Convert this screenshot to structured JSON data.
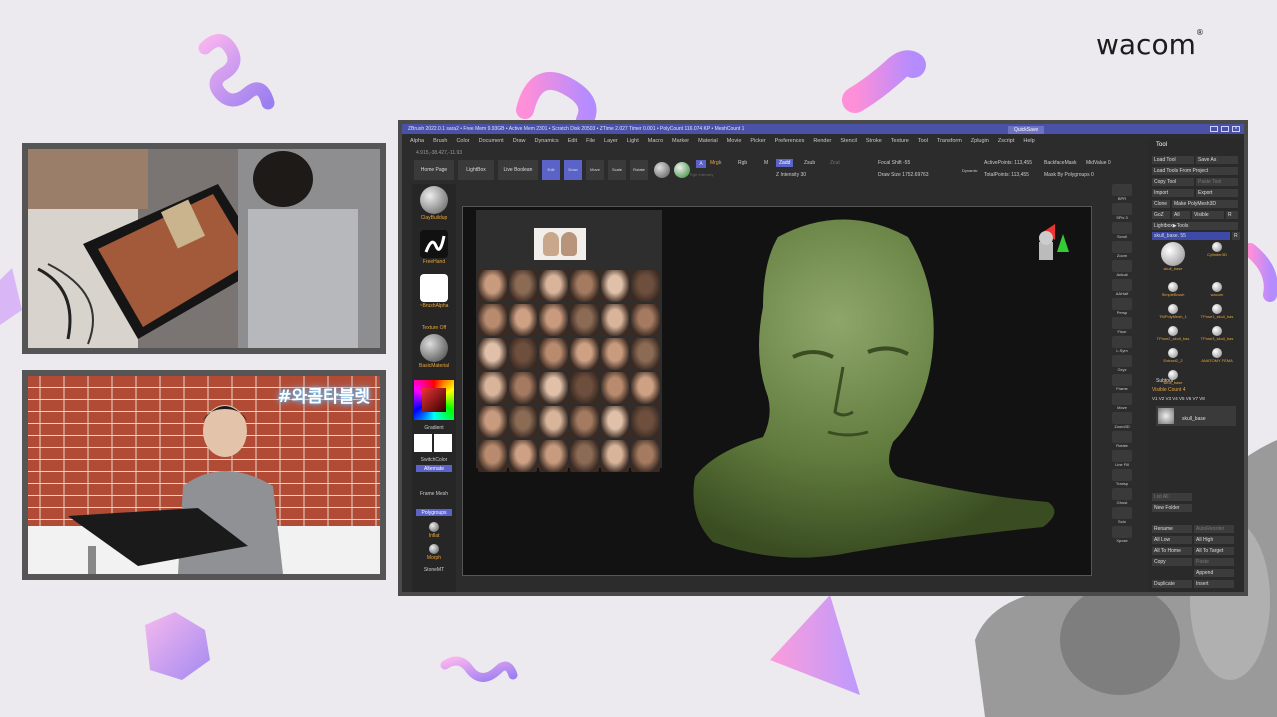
{
  "brand": {
    "logo_text": "wacom",
    "logo_mark": "®"
  },
  "camera2": {
    "overlay_tag": "#와콤타블렛"
  },
  "zbrush": {
    "title_bar": "ZBrush 2022.0.1   sara2   • Free Mem 9.93GB • Active Mem 2301 • Scratch Disk 20503 • ZTime 2.027 Timer 0.001 • PolyCount 116.074 KP • MeshCount 1",
    "quicksave": "QuickSave",
    "menu": [
      "Alpha",
      "Brush",
      "Color",
      "Document",
      "Draw",
      "Dynamics",
      "Edit",
      "File",
      "Layer",
      "Light",
      "Macro",
      "Marker",
      "Material",
      "Movie",
      "Picker",
      "Preferences",
      "Render",
      "Stencil",
      "Stroke",
      "Texture",
      "Tool",
      "Transform",
      "Zplugin",
      "Zscript",
      "Help"
    ],
    "coords": "4.915,-38.427,-11.93",
    "toolbar": {
      "home_page": "Home Page",
      "lightbox": "LightBox",
      "live_boolean": "Live Boolean",
      "edit": "Edit",
      "draw": "Draw",
      "move": "Move",
      "scale": "Scale",
      "rotate": "Rotate",
      "mrgb": "Mrgb",
      "rgb": "Rgb",
      "m": "M",
      "zadd": "Zadd",
      "zsub": "Zsub",
      "zcut": "Zcut",
      "rgb_intensity": "Rgb Intensity",
      "z_intensity": "Z Intensity 30",
      "focal_shift": "Focal Shift -55",
      "draw_size": "Draw Size 1752.69763",
      "dynamic": "Dynamic",
      "active_points": "ActivePoints: 113,455",
      "total_points": "TotalPoints: 113,455",
      "backface_mask": "BackfaceMask",
      "midvalue": "MidValue 0",
      "mask_by_polygroups": "Mask By Polygroups 0"
    },
    "left_shelf": {
      "brush1": "ClayBuildup",
      "brush2": "FreeHand",
      "alpha": "~BrushAlpha",
      "texture": "Texture Off",
      "material": "BasicMaterial",
      "gradient": "Gradient",
      "switch_color": "SwitchColor",
      "alternate": "Alternate",
      "frame_mesh": "Frame Mesh",
      "polygroups": "Polygroups",
      "inflat": "Inflat",
      "morph": "Morph",
      "stone": "StoneMT"
    },
    "right_icons": [
      "BPR",
      "SPix 3",
      "Scroll",
      "Zoom",
      "Actual",
      "AAHalf",
      "Persp",
      "Floor",
      "L.Sym",
      "Gxyz",
      "Frame",
      "Move",
      "Zoom3D",
      "Rotate",
      "Line Fill",
      "Transp",
      "Ghost",
      "Solo",
      "Xpose"
    ],
    "tool_panel": {
      "header": "Tool",
      "load_tool": "Load Tool",
      "save_as": "Save As",
      "load_from_project": "Load Tools From Project",
      "copy_tool": "Copy Tool",
      "paste_tool": "Paste Tool",
      "import": "Import",
      "export": "Export",
      "clone": "Clone",
      "make_polymesh": "Make PolyMesh3D",
      "goz": "GoZ",
      "all": "All",
      "visible": "Visible",
      "r": "R",
      "lightbox_tools": "Lightbox▶Tools",
      "current_tool": "skull_base. 55",
      "tools": [
        "skull_base",
        "Cylinder3D",
        "SimpleBrush",
        "wacom",
        "TMPolyMesh_1",
        "TPose1_skull_bas",
        "TPose2_skull_bas",
        "TPose3_skull_bas",
        "Extract2_2",
        "ANATOMY FEMA",
        "skull_base"
      ],
      "subtool": "Subtool",
      "visible_count": "Visible Count 4",
      "subtool_item": "skull_base",
      "list_all": "List All",
      "new_folder": "New Folder",
      "rename": "Rename",
      "autoreorder": "AutoReorder",
      "all_low": "All Low",
      "all_high": "All High",
      "all_to_home": "All To Home",
      "all_to_target": "All To Target",
      "copy": "Copy",
      "paste": "Paste",
      "append": "Append",
      "duplicate": "Duplicate",
      "insert": "Insert"
    }
  }
}
